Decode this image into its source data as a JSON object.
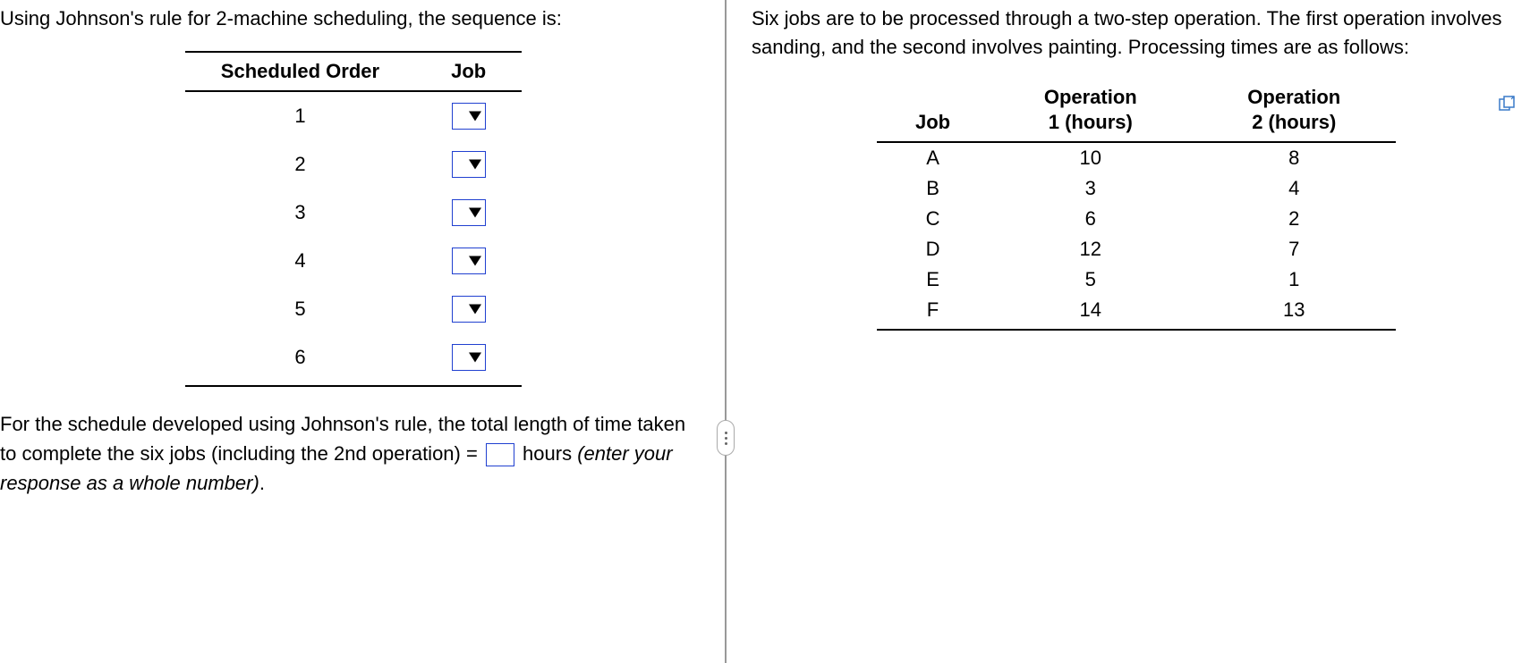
{
  "left": {
    "intro": "Using Johnson's rule for 2-machine scheduling, the sequence is:",
    "table": {
      "headers": {
        "order": "Scheduled Order",
        "job": "Job"
      },
      "rows": [
        {
          "order": "1"
        },
        {
          "order": "2"
        },
        {
          "order": "3"
        },
        {
          "order": "4"
        },
        {
          "order": "5"
        },
        {
          "order": "6"
        }
      ]
    },
    "question_pre": "For the schedule developed using Johnson's rule, the total length of time taken to complete the six jobs (including the 2nd operation) = ",
    "question_post": " hours ",
    "question_hint": "(enter your response as a whole number)",
    "question_end": "."
  },
  "right": {
    "intro": "Six jobs are to be processed through a two-step operation.  The first operation involves sanding, and the second involves painting. Processing times are as follows:",
    "table": {
      "headers": {
        "job": "Job",
        "op1_line1": "Operation",
        "op1_line2": "1 (hours)",
        "op2_line1": "Operation",
        "op2_line2": "2 (hours)"
      },
      "rows": [
        {
          "job": "A",
          "op1": "10",
          "op2": "8"
        },
        {
          "job": "B",
          "op1": "3",
          "op2": "4"
        },
        {
          "job": "C",
          "op1": "6",
          "op2": "2"
        },
        {
          "job": "D",
          "op1": "12",
          "op2": "7"
        },
        {
          "job": "E",
          "op1": "5",
          "op2": "1"
        },
        {
          "job": "F",
          "op1": "14",
          "op2": "13"
        }
      ]
    }
  }
}
